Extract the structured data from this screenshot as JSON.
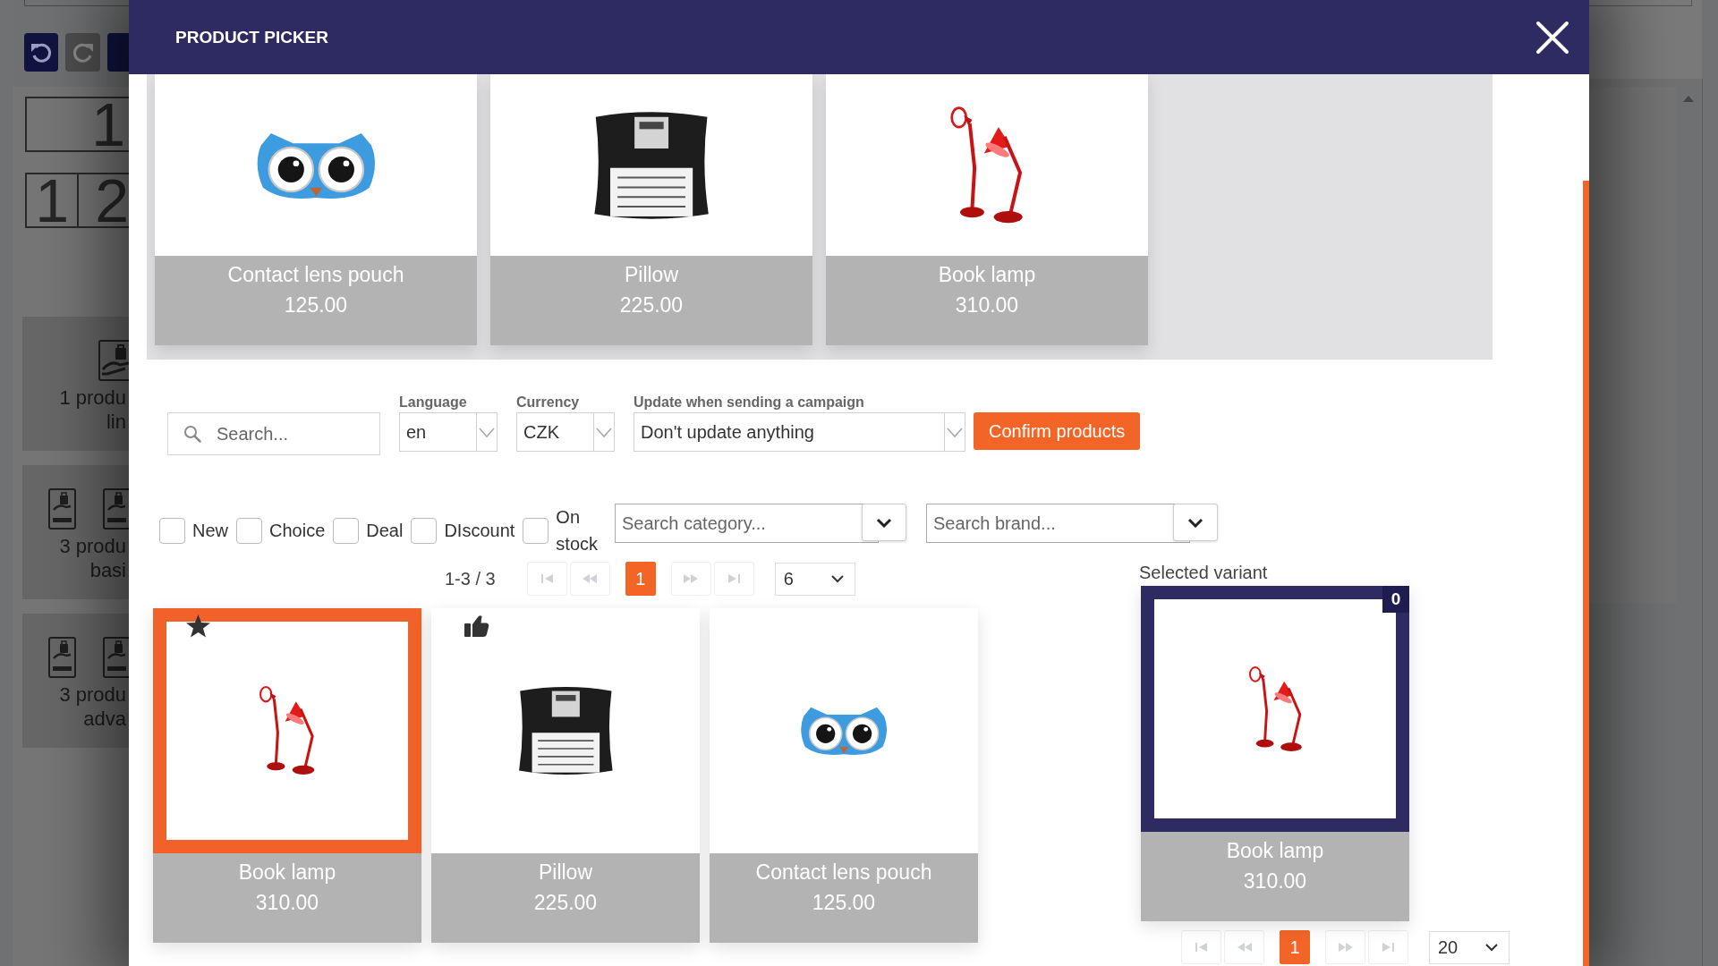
{
  "editor": {
    "toolbar": [
      {
        "kind": "undo",
        "disabled": false
      },
      {
        "kind": "redo",
        "disabled": true
      },
      {
        "kind": "plain",
        "disabled": false
      }
    ],
    "layout_rows": [
      {
        "cells": [
          "1"
        ]
      },
      {
        "cells": [
          "1",
          "2"
        ]
      }
    ],
    "blocks": [
      {
        "kind": "single",
        "lines": [
          "1 produ",
          "lin"
        ]
      },
      {
        "kind": "triple",
        "lines": [
          "3 produ",
          "basi"
        ]
      },
      {
        "kind": "triple",
        "lines": [
          "3 produ",
          "adva"
        ]
      }
    ]
  },
  "modal": {
    "title": "PRODUCT PICKER"
  },
  "picked_products": [
    {
      "kind": "lens_case",
      "name": "Contact lens pouch",
      "price": "125.00"
    },
    {
      "kind": "pillow",
      "name": "Pillow",
      "price": "225.00"
    },
    {
      "kind": "lamp",
      "name": "Book lamp",
      "price": "310.00"
    }
  ],
  "filters": {
    "search": {
      "placeholder": "Search..."
    },
    "selects": [
      {
        "label": "Language",
        "value": "en"
      },
      {
        "label": "Currency",
        "value": "CZK"
      },
      {
        "label": "Update when sending a campaign",
        "value": "Don't update anything"
      }
    ],
    "confirm_button": "Confirm products",
    "flags": [
      {
        "label": "New",
        "checked": false
      },
      {
        "label": "Choice",
        "checked": false
      },
      {
        "label": "Deal",
        "checked": false
      },
      {
        "label": "DIscount",
        "checked": false
      },
      {
        "label": "On stock",
        "checked": false
      }
    ],
    "category_search": {
      "placeholder": "Search category..."
    },
    "brand_search": {
      "placeholder": "Search brand..."
    }
  },
  "results": {
    "range": "1-3 / 3",
    "pager": [
      {
        "kind": "first",
        "disabled": true
      },
      {
        "kind": "prev",
        "disabled": true
      },
      {
        "kind": "page",
        "label": "1",
        "selected": true
      },
      {
        "kind": "next",
        "disabled": true
      },
      {
        "kind": "last",
        "disabled": true
      }
    ],
    "per_page": "6",
    "products": [
      {
        "kind": "lamp",
        "name": "Book lamp",
        "price": "310.00",
        "selected": true,
        "badge": {
          "kind": "star"
        }
      },
      {
        "kind": "pillow",
        "name": "Pillow",
        "price": "225.00",
        "selected": false,
        "badge": {
          "kind": "thumb"
        }
      },
      {
        "kind": "lens_case",
        "name": "Contact lens pouch",
        "price": "125.00",
        "selected": false
      }
    ]
  },
  "selected_variant": {
    "label": "Selected variant",
    "count": "0",
    "product": {
      "kind": "lamp",
      "name": "Book lamp",
      "price": "310.00"
    },
    "pager": [
      {
        "kind": "first",
        "disabled": true
      },
      {
        "kind": "prev",
        "disabled": true
      },
      {
        "kind": "page",
        "label": "1",
        "selected": true
      },
      {
        "kind": "next",
        "disabled": true
      },
      {
        "kind": "last",
        "disabled": true
      }
    ],
    "per_page": "20"
  }
}
